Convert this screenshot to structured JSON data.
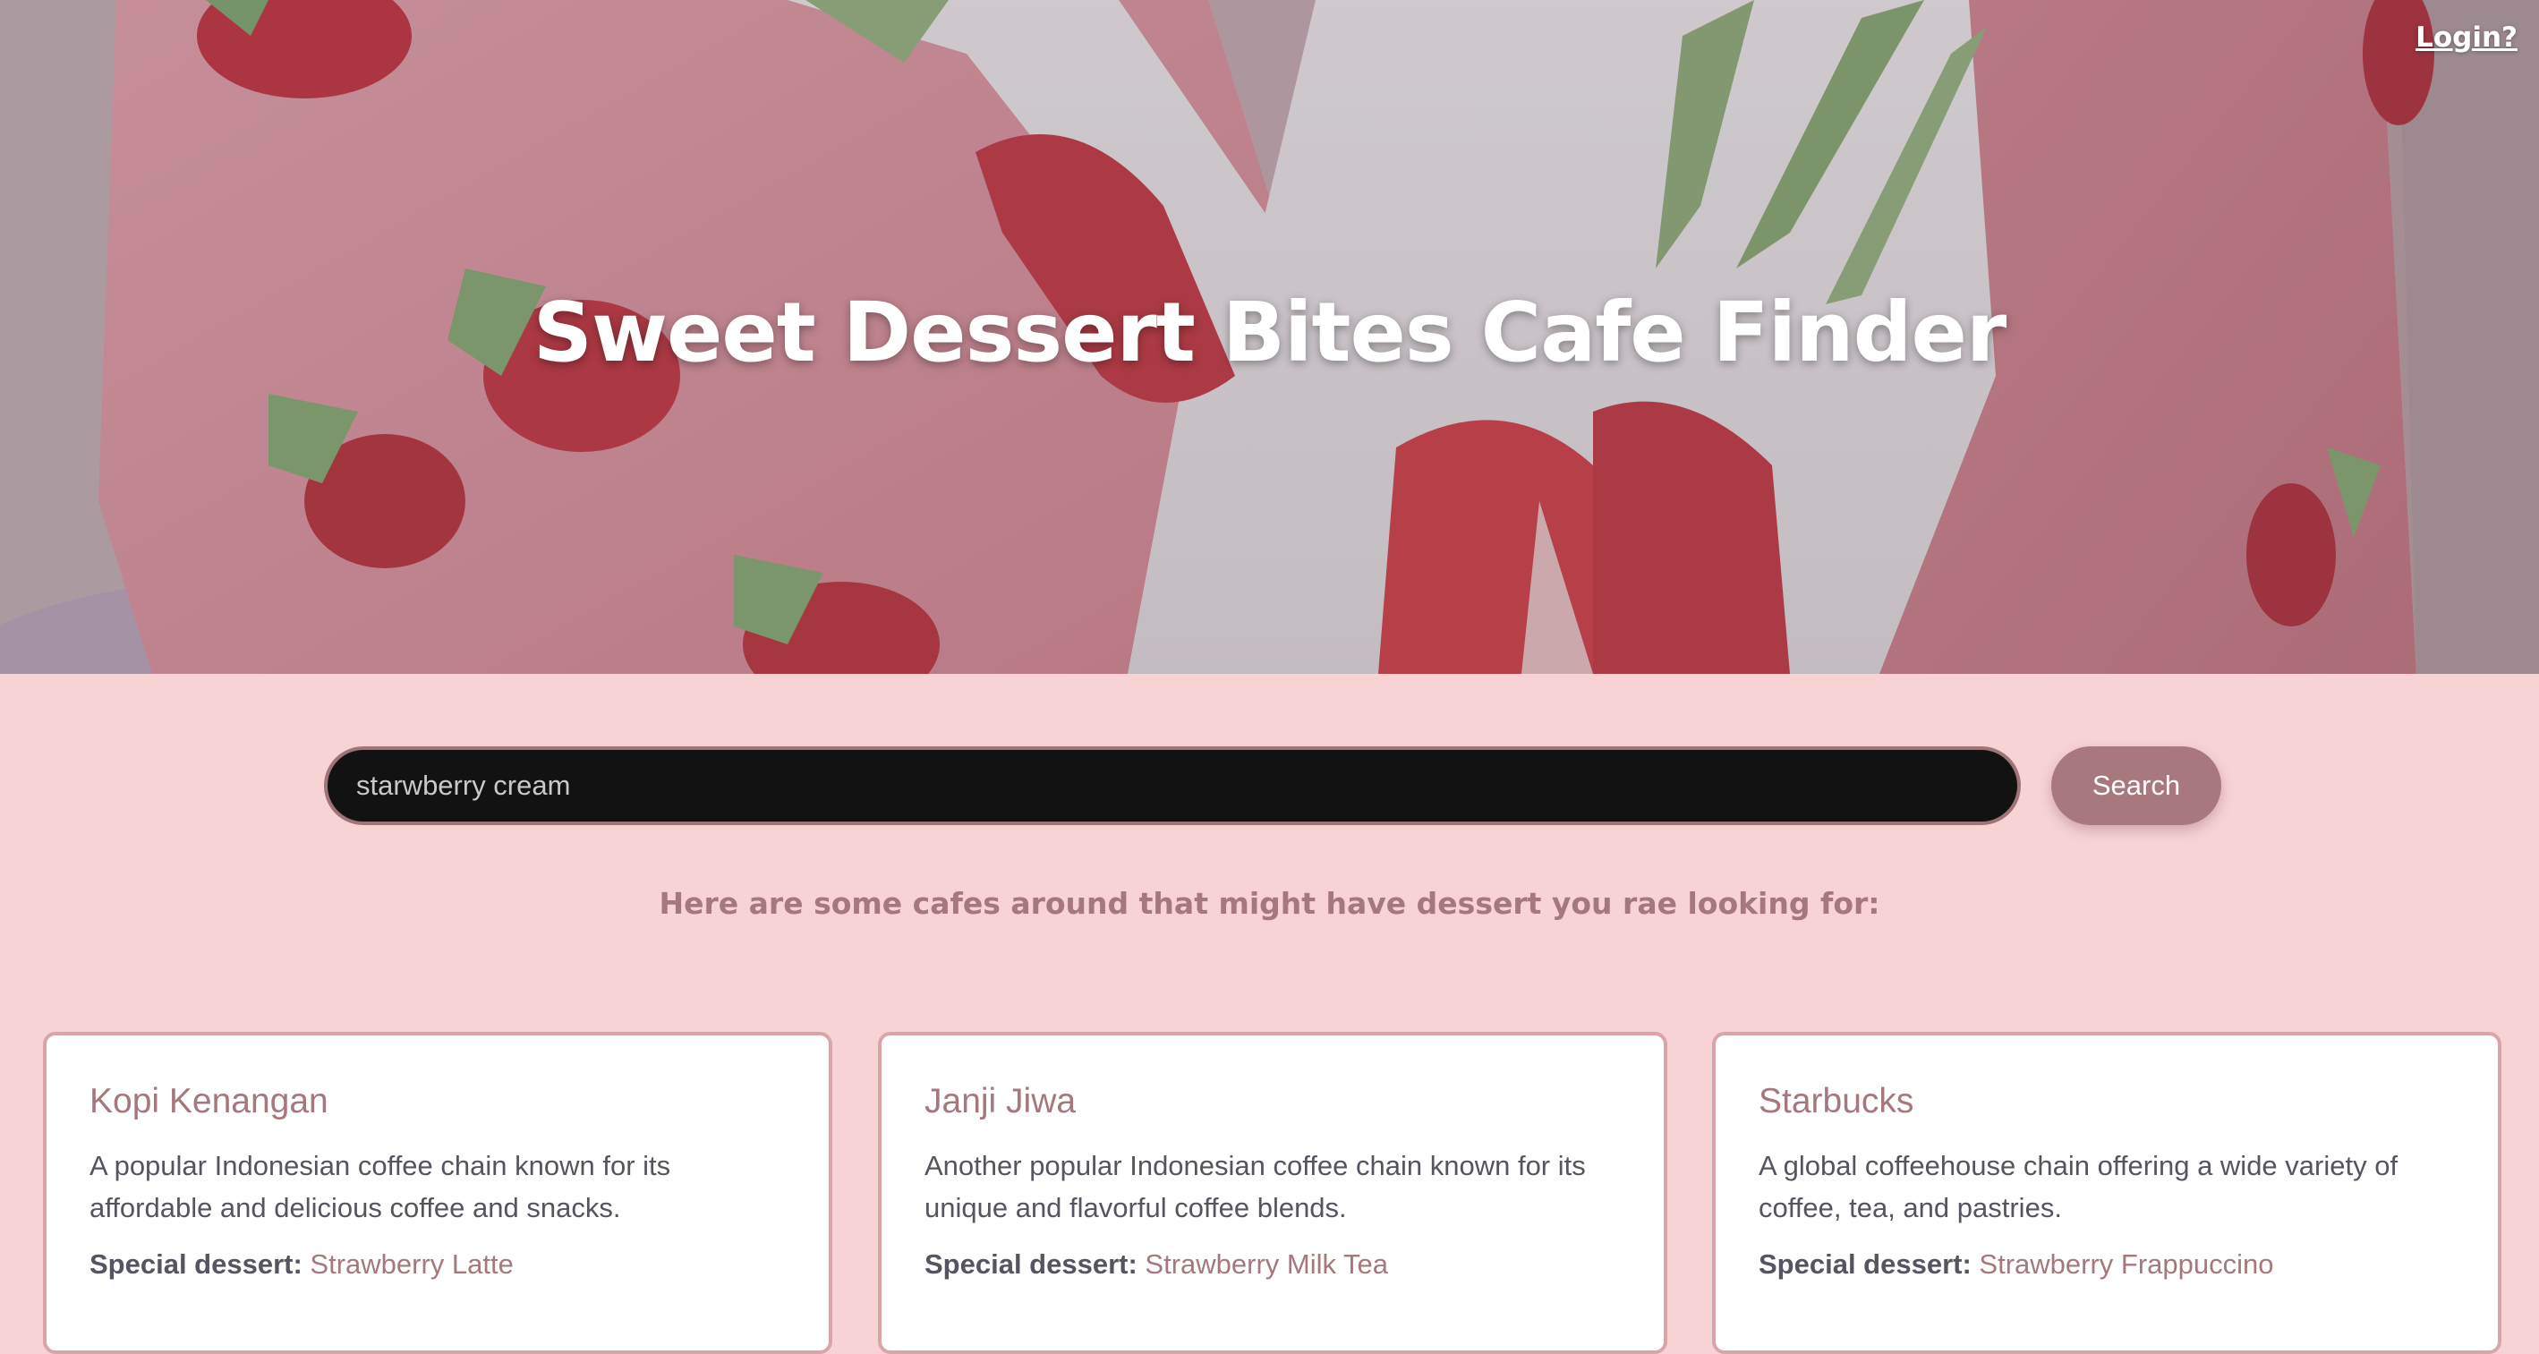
{
  "colors": {
    "page_bg": "#f7d3d3",
    "accent": "#a5787c",
    "button": "#a9787d",
    "card_border": "#dba4a8",
    "input_bg": "#121212",
    "body_text": "#555561"
  },
  "header": {
    "login_label": "Login?",
    "title": "Sweet Dessert Bites Cafe Finder",
    "background_icon": "strawberry-cake-photo"
  },
  "search": {
    "value": "starwberry cream",
    "placeholder": "",
    "button_label": "Search"
  },
  "results": {
    "heading": "Here are some cafes around that might have dessert you rae looking for:",
    "cafes": [
      {
        "name": "Kopi Kenangan",
        "description": "A popular Indonesian coffee chain known for its affordable and delicious coffee and snacks.",
        "special_label": "Special dessert:",
        "special_dessert": "Strawberry Latte"
      },
      {
        "name": "Janji Jiwa",
        "description": "Another popular Indonesian coffee chain known for its unique and flavorful coffee blends.",
        "special_label": "Special dessert:",
        "special_dessert": "Strawberry Milk Tea"
      },
      {
        "name": "Starbucks",
        "description": "A global coffeehouse chain offering a wide variety of coffee, tea, and pastries.",
        "special_label": "Special dessert:",
        "special_dessert": "Strawberry Frappuccino"
      }
    ]
  }
}
